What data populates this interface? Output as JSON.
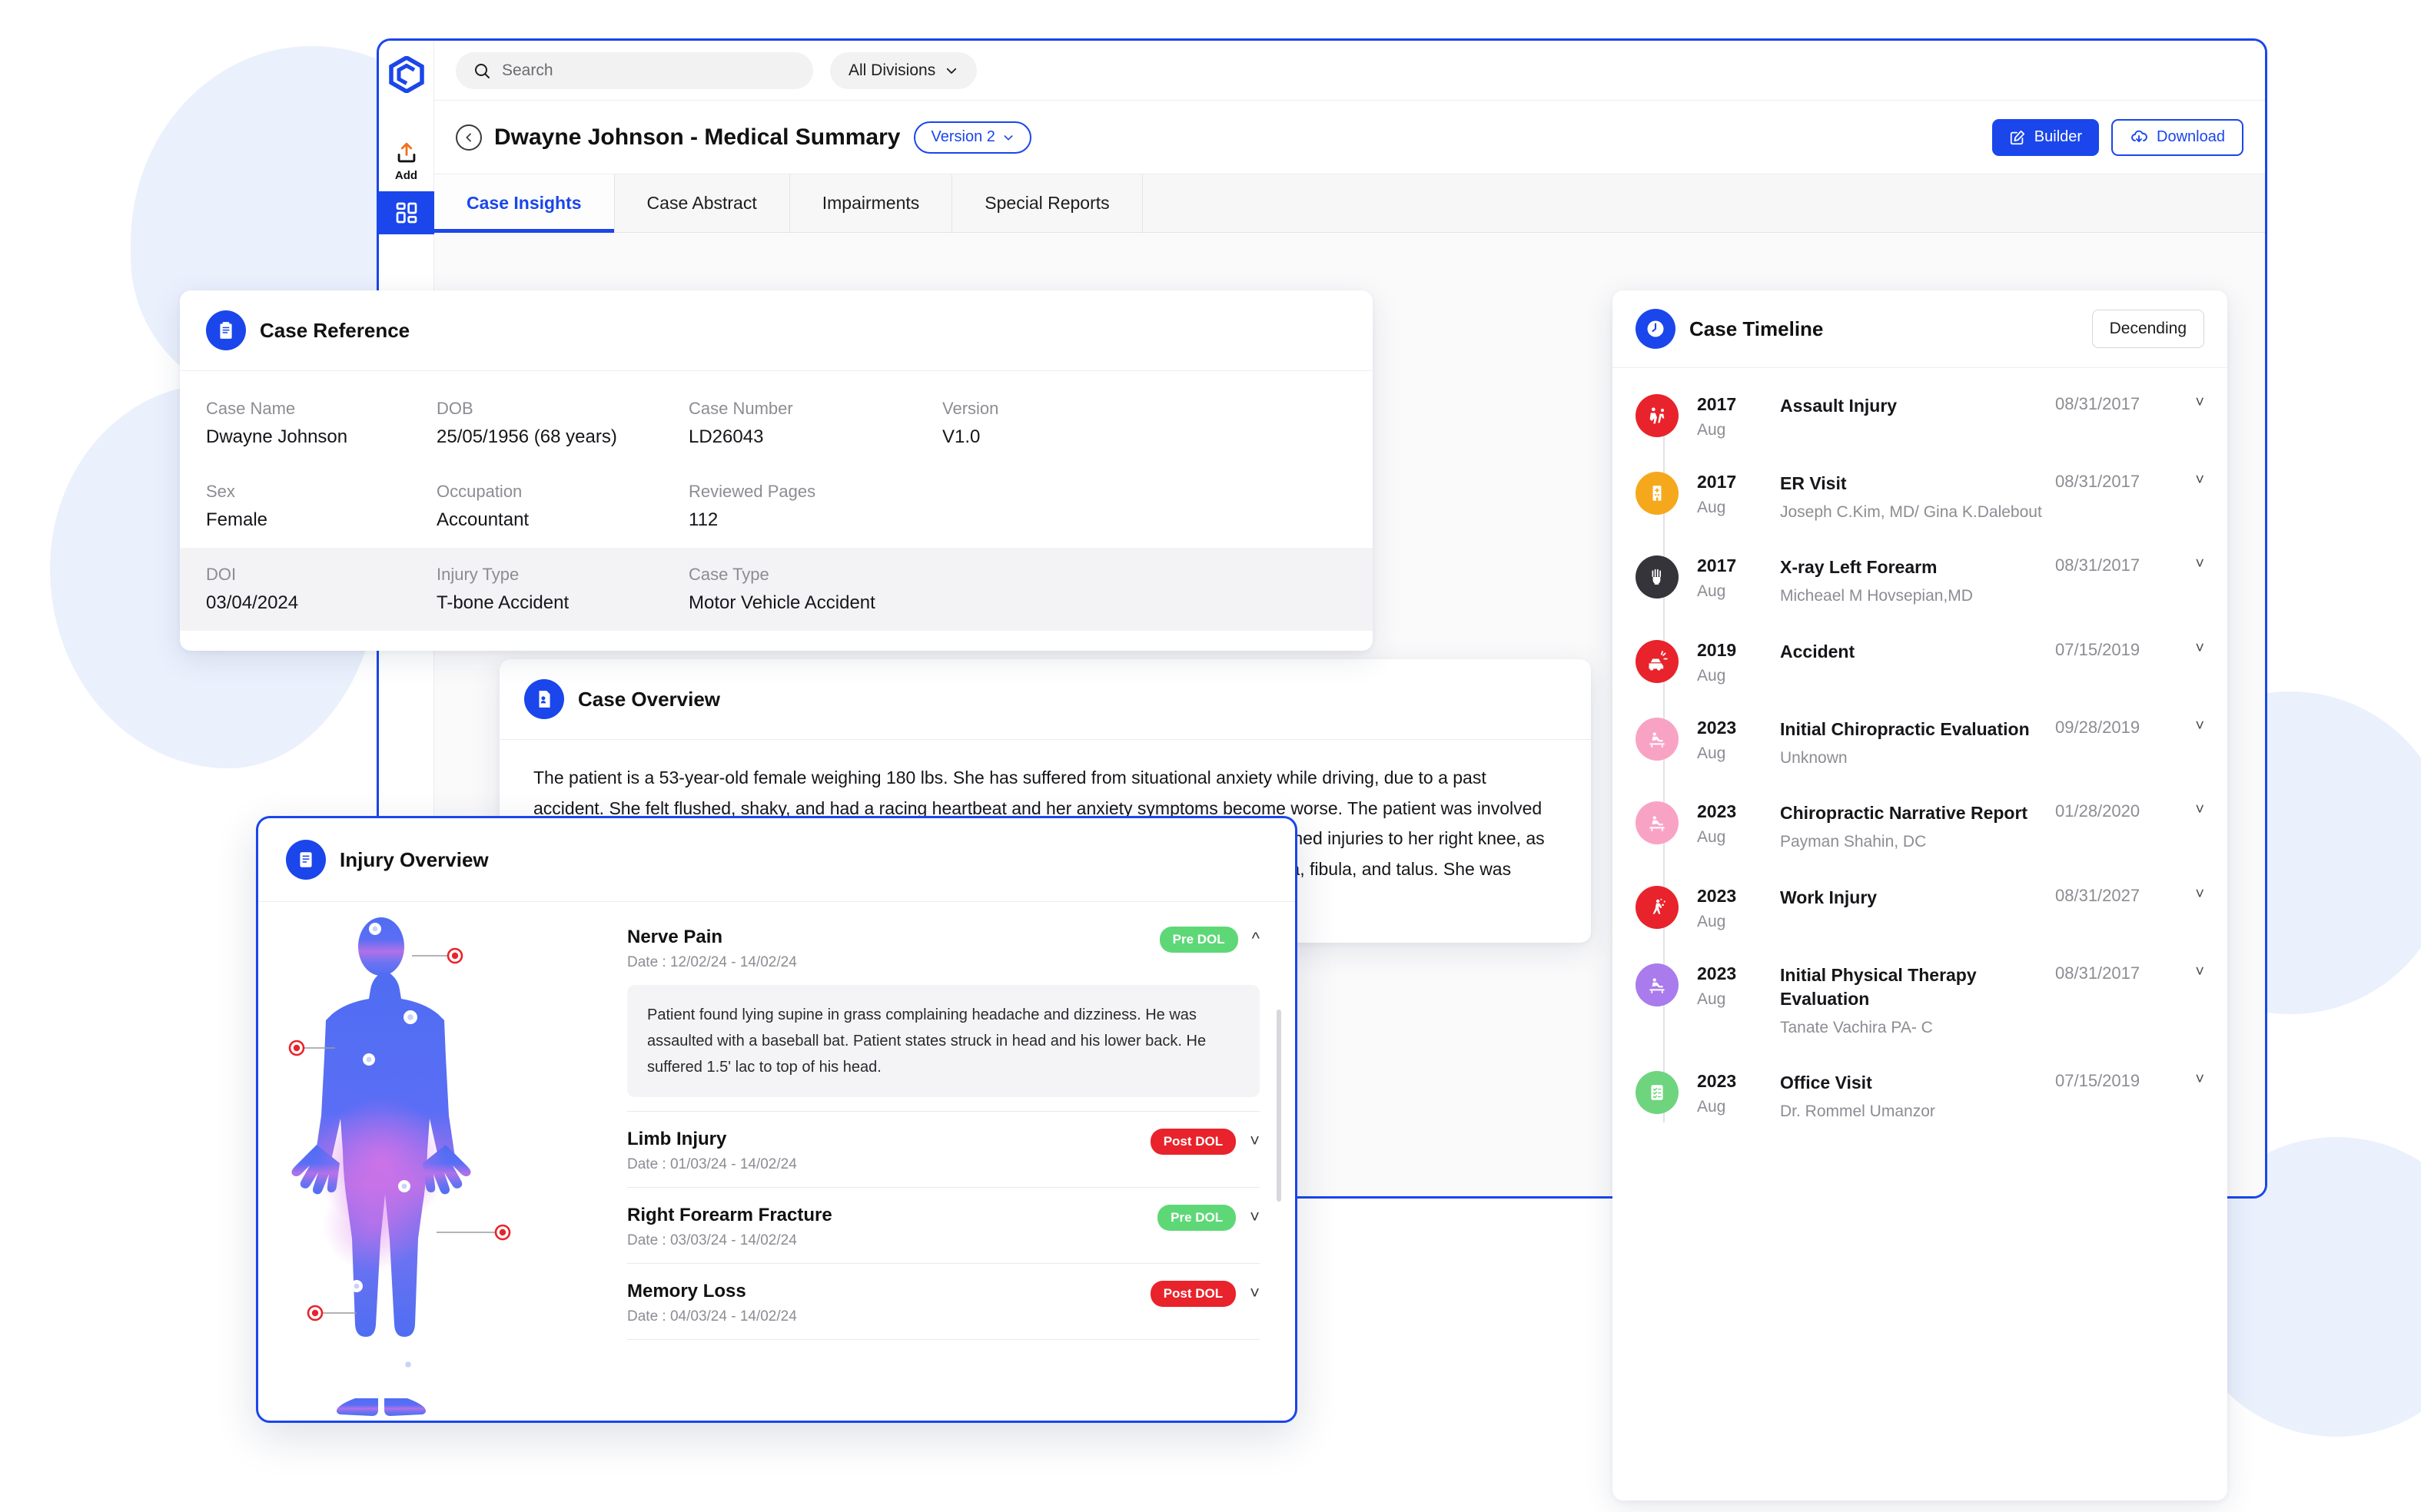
{
  "brand": {
    "accent": "#1a46eb",
    "logo_icon": "hexagon-c-logo"
  },
  "rail": {
    "items": [
      {
        "icon": "upload-icon",
        "label": "Add",
        "active": false
      },
      {
        "icon": "grid-dashboard-icon",
        "label": "",
        "active": true
      },
      {
        "icon": "document-edit-icon",
        "label": "",
        "active": false
      },
      {
        "icon": "calendar-list-icon",
        "label": "",
        "active": false
      },
      {
        "icon": "certificate-icon",
        "label": "",
        "active": false
      }
    ]
  },
  "topbar": {
    "search": {
      "icon": "search-icon",
      "placeholder": "Search",
      "value": ""
    },
    "divisions": {
      "label": "All Divisions",
      "icon": "chevron-down-icon"
    }
  },
  "header": {
    "back_icon": "chevron-left-circle-icon",
    "title": "Dwayne Johnson - Medical Summary",
    "version_chip": "Version 2",
    "builder_label": "Builder",
    "builder_icon": "edit-square-icon",
    "download_label": "Download",
    "download_icon": "cloud-download-icon"
  },
  "tabs": [
    {
      "label": "Case Insights",
      "active": true
    },
    {
      "label": "Case Abstract",
      "active": false
    },
    {
      "label": "Impairments",
      "active": false
    },
    {
      "label": "Special Reports",
      "active": false
    }
  ],
  "case_reference": {
    "title": "Case Reference",
    "icon": "clipboard-icon",
    "rows": [
      [
        {
          "key": "Case Name",
          "value": "Dwayne Johnson"
        },
        {
          "key": "DOB",
          "value": "25/05/1956  (68 years)"
        },
        {
          "key": "Case Number",
          "value": "LD26043"
        },
        {
          "key": "Version",
          "value": "V1.0"
        }
      ],
      [
        {
          "key": "Sex",
          "value": "Female"
        },
        {
          "key": "Occupation",
          "value": "Accountant"
        },
        {
          "key": "Reviewed Pages",
          "value": "112"
        },
        {
          "key": "",
          "value": ""
        }
      ],
      [
        {
          "key": "DOI",
          "value": "03/04/2024"
        },
        {
          "key": "Injury Type",
          "value": "T-bone Accident"
        },
        {
          "key": "Case Type",
          "value": "Motor Vehicle Accident"
        },
        {
          "key": "",
          "value": ""
        }
      ]
    ]
  },
  "case_overview": {
    "title": "Case Overview",
    "icon": "document-person-icon",
    "paragraph": "The patient is a 53-year-old female weighing 180 lbs. She has suffered from situational anxiety while driving, due to a past accident. She felt flushed, shaky, and had a racing heartbeat and her anxiety symptoms become worse. The patient was involved in a motor vehicle accident on June 14, and was trapped inside and unable to escape. She sustained injuries to her right knee, as well as right-sided neck and shoulder pain. She was diagnosed with mild fractures of the right tibia, fibula, and talus. She was treated conservatively with physical therapy and medication."
  },
  "injury_overview": {
    "title": "Injury Overview",
    "icon": "clipboard-lines-icon",
    "figure_icon": "human-body-anterior-figure",
    "items": [
      {
        "name": "Nerve Pain",
        "date": "Date : 12/02/24 - 14/02/24",
        "badge": "Pre DOL",
        "badge_type": "pre",
        "expanded": true,
        "detail": "Patient found lying supine in grass complaining headache and dizziness. He was assaulted with a baseball bat. Patient states struck in head and his lower back. He suffered 1.5' lac to top of his head."
      },
      {
        "name": "Limb Injury",
        "date": "Date : 01/03/24 - 14/02/24",
        "badge": "Post DOL",
        "badge_type": "post",
        "expanded": false,
        "detail": ""
      },
      {
        "name": "Right Forearm Fracture",
        "date": "Date : 03/03/24 - 14/02/24",
        "badge": "Pre DOL",
        "badge_type": "pre",
        "expanded": false,
        "detail": ""
      },
      {
        "name": "Memory Loss",
        "date": "Date : 04/03/24 - 14/02/24",
        "badge": "Post DOL",
        "badge_type": "post",
        "expanded": false,
        "detail": ""
      }
    ]
  },
  "case_timeline": {
    "title": "Case Timeline",
    "icon": "clock-icon",
    "sort_label": "Decending",
    "items": [
      {
        "year": "2017",
        "month": "Aug",
        "title": "Assault Injury",
        "subtitle": "",
        "date": "08/31/2017",
        "icon": "assault-icon",
        "color": "#e8232b"
      },
      {
        "year": "2017",
        "month": "Aug",
        "title": "ER Visit",
        "subtitle": "Joseph C.Kim, MD/ Gina K.Dalebout",
        "date": "08/31/2017",
        "icon": "hospital-icon",
        "color": "#f6a81c"
      },
      {
        "year": "2017",
        "month": "Aug",
        "title": "X-ray Left Forearm",
        "subtitle": "Micheael M Hovsepian,MD",
        "date": "08/31/2017",
        "icon": "xray-hand-icon",
        "color": "#34343a"
      },
      {
        "year": "2019",
        "month": "Aug",
        "title": "Accident",
        "subtitle": "",
        "date": "07/15/2019",
        "icon": "car-accident-icon",
        "color": "#e8232b"
      },
      {
        "year": "2023",
        "month": "Aug",
        "title": "Initial Chiropractic Evaluation",
        "subtitle": "Unknown",
        "date": "09/28/2019",
        "icon": "massage-therapy-icon",
        "color": "#f9a3c4"
      },
      {
        "year": "2023",
        "month": "Aug",
        "title": "Chiropractic Narrative Report",
        "subtitle": "Payman Shahin, DC",
        "date": "01/28/2020",
        "icon": "massage-therapy-icon",
        "color": "#f9a3c4"
      },
      {
        "year": "2023",
        "month": "Aug",
        "title": "Work Injury",
        "subtitle": "",
        "date": "08/31/2027",
        "icon": "work-injury-icon",
        "color": "#e8232b"
      },
      {
        "year": "2023",
        "month": "Aug",
        "title": "Initial Physical Therapy Evaluation",
        "subtitle": "Tanate Vachira PA- C",
        "date": "08/31/2017",
        "icon": "massage-therapy-icon",
        "color": "#a97bec"
      },
      {
        "year": "2023",
        "month": "Aug",
        "title": "Office Visit",
        "subtitle": "Dr. Rommel Umanzor",
        "date": "07/15/2019",
        "icon": "checklist-icon",
        "color": "#6fd47e"
      }
    ]
  }
}
